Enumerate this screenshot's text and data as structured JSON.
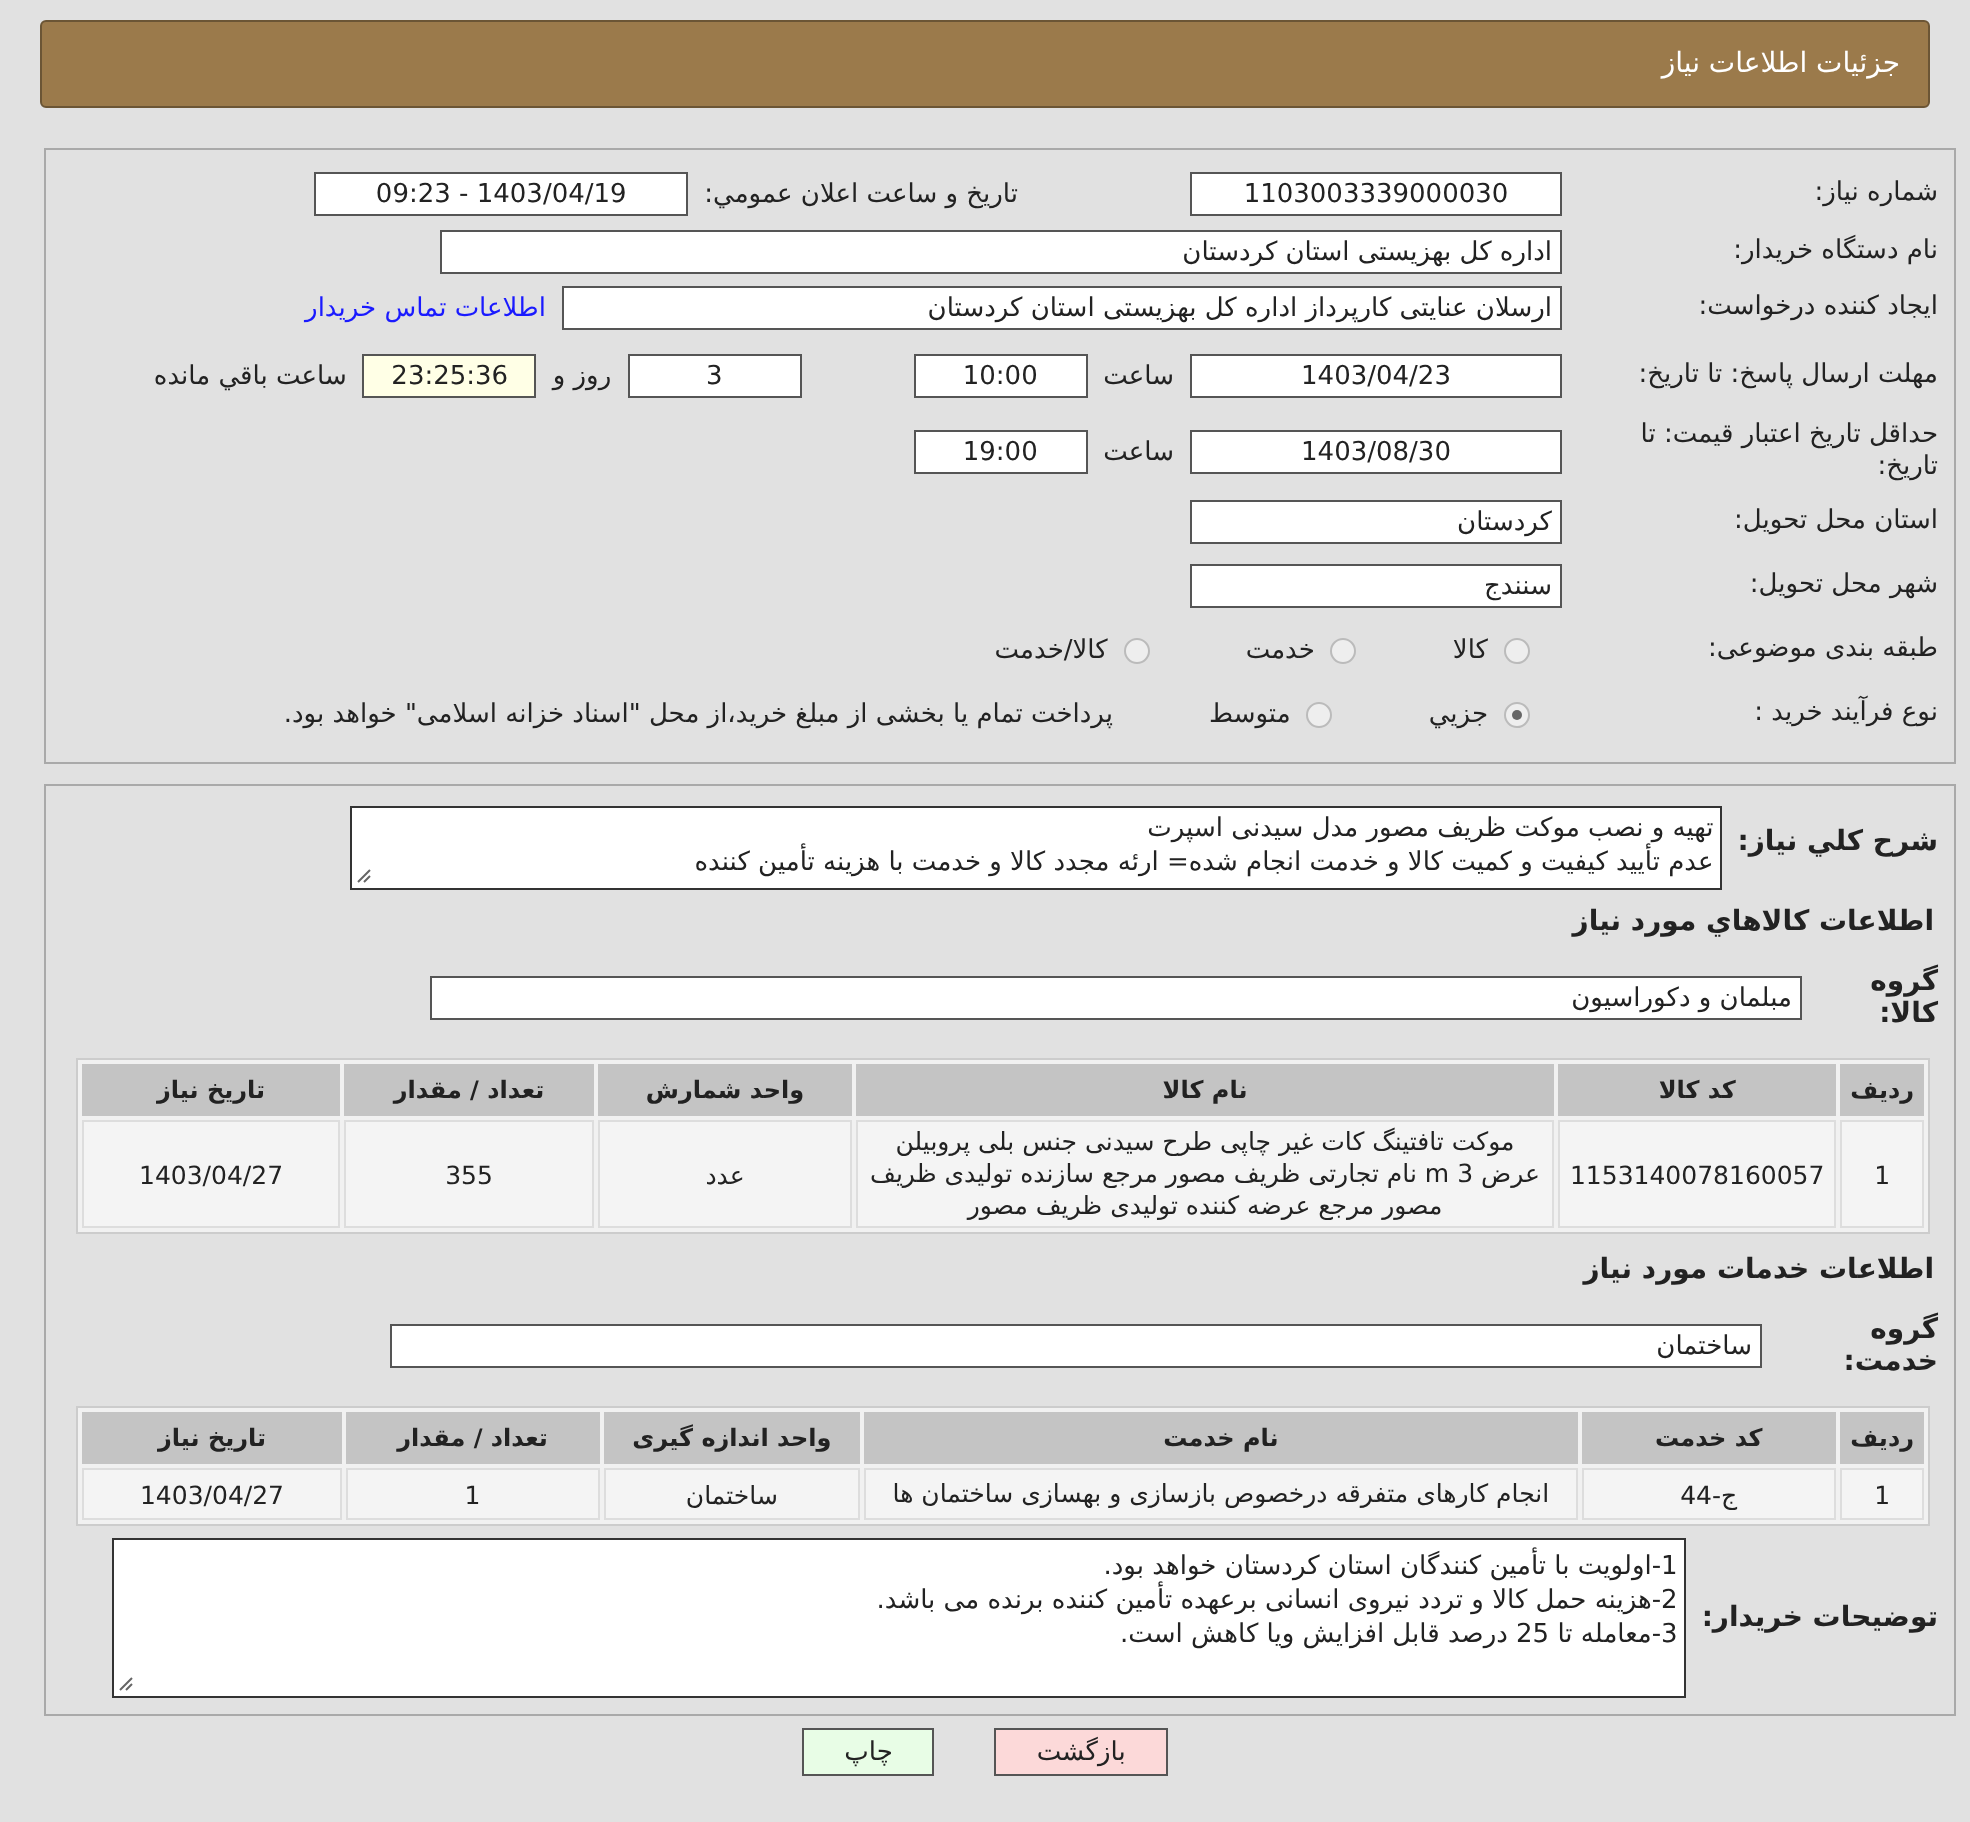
{
  "header": {
    "title": "جزئیات اطلاعات نیاز"
  },
  "details": {
    "need_number": {
      "label": "شماره نیاز:",
      "value": "1103003339000030"
    },
    "announce": {
      "label": "تاریخ و ساعت اعلان عمومي:",
      "value": "1403/04/19 - 09:23"
    },
    "buyer": {
      "label": "نام دستگاه خریدار:",
      "value": "اداره کل بهزیستی استان کردستان"
    },
    "creator": {
      "label": "ایجاد کننده درخواست:",
      "value": "ارسلان  عنایتی کارپرداز اداره کل بهزیستی استان کردستان",
      "link": "اطلاعات تماس خریدار"
    },
    "deadline": {
      "label": "مهلت ارسال پاسخ: تا تاریخ:",
      "date": "1403/04/23",
      "time_label": "ساعت",
      "time": "10:00",
      "days": "3",
      "days_label": "روز و",
      "remaining": "23:25:36",
      "remaining_label": "ساعت باقي مانده"
    },
    "validity": {
      "label": "حداقل تاریخ اعتبار قیمت: تا تاریخ:",
      "date": "1403/08/30",
      "time_label": "ساعت",
      "time": "19:00"
    },
    "province": {
      "label": "استان محل تحویل:",
      "value": "کردستان"
    },
    "city": {
      "label": "شهر محل تحویل:",
      "value": "سنندج"
    },
    "category": {
      "label": "طبقه بندی موضوعی:",
      "options": [
        {
          "label": "کالا",
          "selected": false
        },
        {
          "label": "خدمت",
          "selected": false
        },
        {
          "label": "کالا/خدمت",
          "selected": false
        }
      ]
    },
    "process": {
      "label": "نوع فرآیند خرید :",
      "options": [
        {
          "label": "جزيي",
          "selected": true
        },
        {
          "label": "متوسط",
          "selected": false
        }
      ],
      "note": "پرداخت تمام یا بخشی از مبلغ خرید،از محل \"اسناد خزانه اسلامی\" خواهد بود."
    }
  },
  "summary": {
    "label": "شرح کلي نیاز:",
    "lines": [
      "تهیه و نصب موکت ظریف مصور مدل سیدنی اسپرت",
      "عدم تأیید کیفیت و کمیت کالا و خدمت انجام شده=  ارئه مجدد کالا و خدمت با هزینه تأمین کننده"
    ]
  },
  "goods": {
    "title": "اطلاعات كالاهاي مورد نياز",
    "group_label": "گروه کالا:",
    "group": "مبلمان و دکوراسیون",
    "columns": [
      "ردیف",
      "کد کالا",
      "نام کالا",
      "واحد شمارش",
      "تعداد / مقدار",
      "تاریخ نیاز"
    ],
    "rows": [
      [
        "1",
        "1153140078160057",
        "موکت تافتینگ کات غیر چاپی طرح سیدنی جنس بلی پروبیلن عرض 3 m نام تجارتی ظریف مصور مرجع سازنده تولیدی ظریف مصور مرجع عرضه کننده تولیدی ظریف مصور",
        "عدد",
        "355",
        "1403/04/27"
      ]
    ]
  },
  "services": {
    "title": "اطلاعات خدمات مورد نیاز",
    "group_label": "گروه خدمت:",
    "group": "ساختمان",
    "columns": [
      "ردیف",
      "کد خدمت",
      "نام خدمت",
      "واحد اندازه گیری",
      "تعداد / مقدار",
      "تاریخ نیاز"
    ],
    "rows": [
      [
        "1",
        "ج-44",
        "انجام کارهای متفرقه درخصوص بازسازی و بهسازی ساختمان ها",
        "ساختمان",
        "1",
        "1403/04/27"
      ]
    ]
  },
  "buyer_notes": {
    "label": "توضیحات خریدار:",
    "lines": [
      "1-اولویت با تأمین کنندگان استان کردستان خواهد بود.",
      "2-هزینه حمل کالا  و تردد نیروی انسانی برعهده تأمین کننده برنده می باشد.",
      "3-معامله تا 25 درصد قابل افزایش ویا کاهش است."
    ]
  },
  "buttons": [
    {
      "label": "بازگشت",
      "kind": "back"
    },
    {
      "label": "چاپ",
      "kind": "print"
    }
  ]
}
